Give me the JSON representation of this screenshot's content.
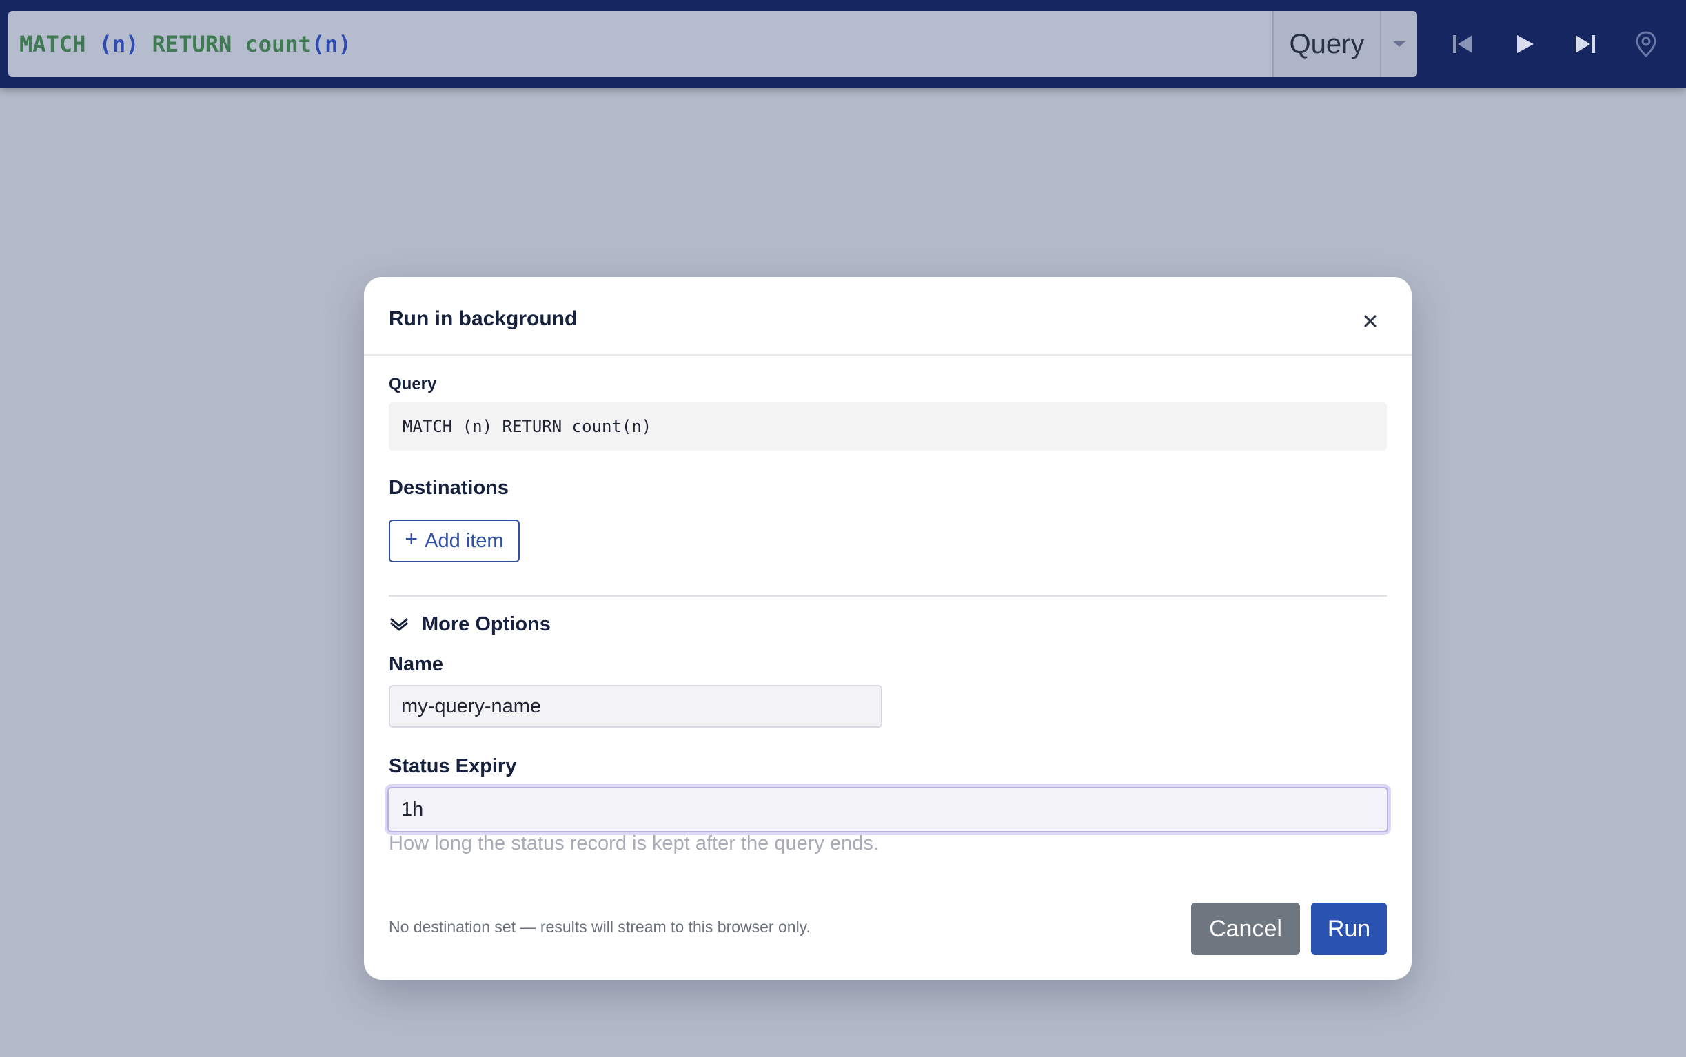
{
  "topbar": {
    "query_text": {
      "kw1": "MATCH",
      "p1": "(n)",
      "kw2": "RETURN",
      "fn": "count",
      "p2": "(n)"
    },
    "query_button_label": "Query",
    "icons": [
      "chevron-down-icon",
      "skip-back-icon",
      "play-icon",
      "skip-forward-icon",
      "location-pin-icon"
    ]
  },
  "modal": {
    "title": "Run in background",
    "query_label": "Query",
    "query_value": "MATCH (n) RETURN count(n)",
    "destinations_label": "Destinations",
    "add_item_label": "Add item",
    "more_options_label": "More Options",
    "name_label": "Name",
    "name_value": "my-query-name",
    "status_expiry_label": "Status Expiry",
    "status_expiry_value": "1h",
    "status_expiry_hint": "How long the status record is kept after the query ends.",
    "footer_note": "No destination set — results will stream to this browser only.",
    "cancel_label": "Cancel",
    "run_label": "Run"
  },
  "colors": {
    "topbar_bg": "#162660",
    "backdrop": "#b4bac9",
    "primary": "#2a52b0",
    "secondary_button": "#6e7680"
  }
}
